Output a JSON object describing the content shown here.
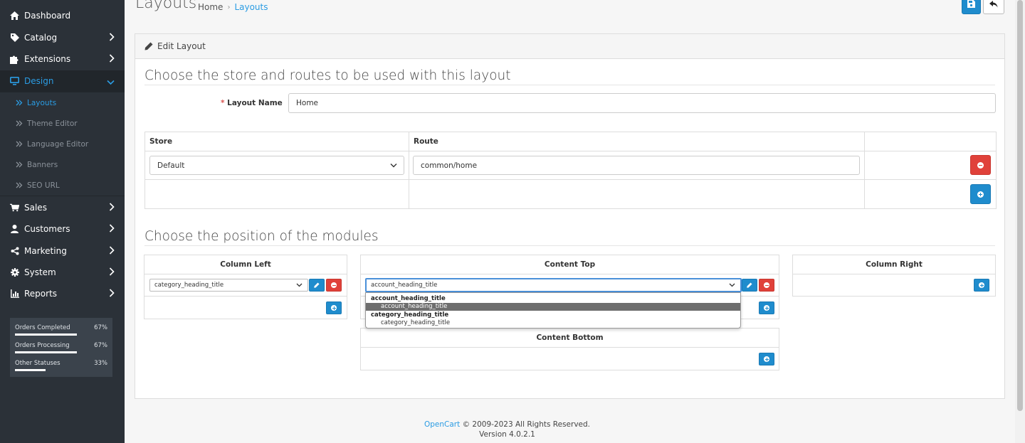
{
  "sidebar": {
    "items": [
      {
        "label": "Dashboard",
        "icon": "home-icon"
      },
      {
        "label": "Catalog",
        "icon": "tag-icon"
      },
      {
        "label": "Extensions",
        "icon": "puzzle-icon"
      },
      {
        "label": "Design",
        "icon": "monitor-icon"
      },
      {
        "label": "Sales",
        "icon": "cart-icon"
      },
      {
        "label": "Customers",
        "icon": "user-icon"
      },
      {
        "label": "Marketing",
        "icon": "share-icon"
      },
      {
        "label": "System",
        "icon": "gear-icon"
      },
      {
        "label": "Reports",
        "icon": "bar-chart-icon"
      }
    ],
    "design_submenu": [
      "Layouts",
      "Theme Editor",
      "Language Editor",
      "Banners",
      "SEO URL"
    ],
    "stats": [
      {
        "label": "Orders Completed",
        "percent": "67%",
        "value": 67
      },
      {
        "label": "Orders Processing",
        "percent": "67%",
        "value": 67
      },
      {
        "label": "Other Statuses",
        "percent": "33%",
        "value": 33
      }
    ]
  },
  "header": {
    "title": "Layouts",
    "breadcrumb": [
      "Home",
      "Layouts"
    ]
  },
  "card": {
    "heading": "Edit Layout",
    "section1_title": "Choose the store and routes to be used with this layout",
    "layout_name_label": "Layout Name",
    "layout_name_value": "Home",
    "route_table": {
      "headers": [
        "Store",
        "Route"
      ],
      "rows": [
        {
          "store": "Default",
          "route": "common/home"
        }
      ]
    },
    "section2_title": "Choose the position of the modules",
    "modules": {
      "column_left": {
        "title": "Column Left",
        "selected": "category_heading_title"
      },
      "content_top": {
        "title": "Content Top",
        "selected": "account_heading_title"
      },
      "column_right": {
        "title": "Column Right"
      },
      "content_bottom": {
        "title": "Content Bottom"
      }
    },
    "dropdown": {
      "groups": [
        {
          "label": "account_heading_title",
          "options": [
            "account_heading_title"
          ]
        },
        {
          "label": "category_heading_title",
          "options": [
            "category_heading_title"
          ]
        }
      ]
    }
  },
  "footer": {
    "brand": "OpenCart",
    "copyright": "© 2009-2023 All Rights Reserved.",
    "version": "Version 4.0.2.1"
  },
  "colors": {
    "accent": "#2b9ce3",
    "danger": "#e0413a",
    "primary": "#1f8ccd",
    "sidebar": "#2b3138"
  }
}
